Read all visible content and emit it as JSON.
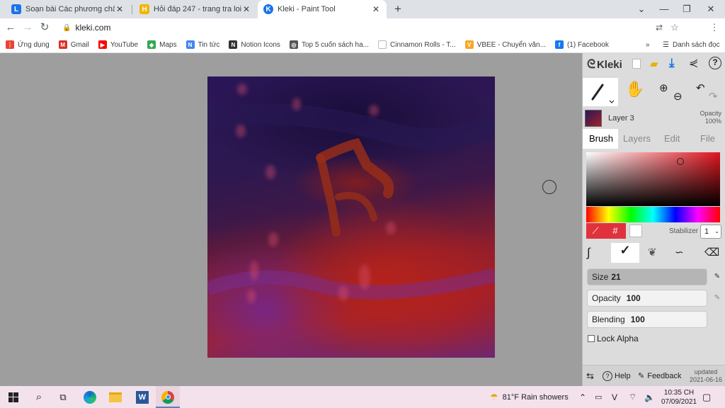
{
  "browser": {
    "tabs": [
      {
        "title": "Soạn bài Các phương châm hội thoại",
        "icon": "letter-l-icon",
        "icon_letter": "L",
        "color": "#1a73e8"
      },
      {
        "title": "Hỏi đáp 247 - trang tra loi",
        "icon": "letter-h-icon",
        "icon_letter": "H",
        "color": "#f4b400"
      },
      {
        "title": "Kleki - Paint Tool",
        "icon": "kleki-icon",
        "icon_letter": "K",
        "color": "#1a73e8",
        "active": true
      }
    ],
    "url": "kleki.com",
    "bookmarks": [
      {
        "label": "Ứng dụng",
        "icon": "apps-grid-icon",
        "color": "#ea4335",
        "glyph": "⋮"
      },
      {
        "label": "Gmail",
        "icon": "gmail-icon",
        "color": "#d93025",
        "glyph": "M"
      },
      {
        "label": "YouTube",
        "icon": "youtube-icon",
        "color": "#ff0000",
        "glyph": "▶"
      },
      {
        "label": "Maps",
        "icon": "maps-icon",
        "color": "#34a853",
        "glyph": "◆"
      },
      {
        "label": "Tin tức",
        "icon": "news-icon",
        "color": "#4285f4",
        "glyph": "N"
      },
      {
        "label": "Notion Icons",
        "icon": "notion-icon",
        "color": "#333333",
        "glyph": "N"
      },
      {
        "label": "Top 5 cuốn sách ha...",
        "icon": "book-site-icon",
        "color": "#555555",
        "glyph": "◎"
      },
      {
        "label": "Cinnamon Rolls - T...",
        "icon": "blank-page-icon",
        "color": "#ffffff",
        "glyph": ""
      },
      {
        "label": "VBEE - Chuyển văn...",
        "icon": "vbee-icon",
        "color": "#f9a825",
        "glyph": "V"
      },
      {
        "label": "(1) Facebook",
        "icon": "facebook-icon",
        "color": "#1877f2",
        "glyph": "f"
      }
    ],
    "bookmarks_more": "»",
    "reading_list": "Danh sách đọc"
  },
  "kleki": {
    "logo": "Kleki",
    "layer_name": "Layer 3",
    "opacity_label": "Opacity",
    "opacity_value": "100%",
    "tabs": [
      "Brush",
      "Layers",
      "Edit",
      "File"
    ],
    "active_tab": "Brush",
    "picked_color": "#e0323c",
    "hex_symbol": "#",
    "stabilizer_label": "Stabilizer",
    "stabilizer_value": "1",
    "size_label": "Size",
    "size_value": "21",
    "brush_opacity_label": "Opacity",
    "brush_opacity_value": "100",
    "blending_label": "Blending",
    "blending_value": "100",
    "lock_alpha": "Lock Alpha",
    "help": "Help",
    "feedback": "Feedback",
    "updated_label": "updated",
    "updated_date": "2021-06-16"
  },
  "taskbar": {
    "weather": "81°F  Rain showers",
    "time": "10:35 CH",
    "date": "07/09/2021"
  }
}
